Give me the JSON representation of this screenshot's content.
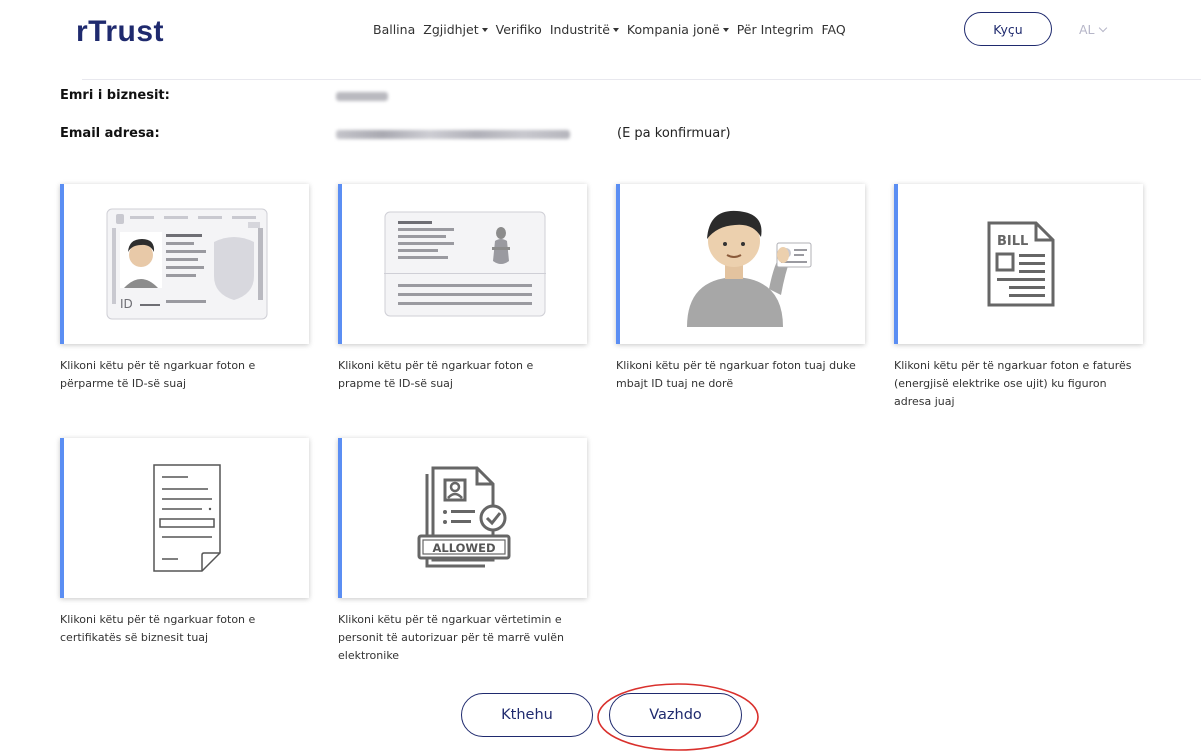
{
  "header": {
    "logo": "rTrust",
    "nav": [
      {
        "label": "Ballina",
        "dropdown": false
      },
      {
        "label": "Zgjidhjet",
        "dropdown": true
      },
      {
        "label": "Verifiko",
        "dropdown": false
      },
      {
        "label": "Industritë",
        "dropdown": true
      },
      {
        "label": "Kompania jonë",
        "dropdown": true
      },
      {
        "label": "Për Integrim",
        "dropdown": false
      },
      {
        "label": "FAQ",
        "dropdown": false
      }
    ],
    "login_label": "Kyçu",
    "language": "AL"
  },
  "info": {
    "business_name_label": "Emri i biznesit:",
    "email_label": "Email adresa:",
    "email_status": "(E pa konfirmuar)"
  },
  "cards": [
    {
      "caption": "Klikoni këtu për të ngarkuar foton e përparme të ID-së suaj",
      "icon": "id-card-front-icon"
    },
    {
      "caption": "Klikoni këtu për të ngarkuar foton e prapme të ID-së suaj",
      "icon": "id-card-back-icon"
    },
    {
      "caption": "Klikoni këtu për të ngarkuar foton tuaj duke mbajt ID tuaj ne dorë",
      "icon": "selfie-with-id-icon"
    },
    {
      "caption": "Klikoni këtu për të ngarkuar foton e faturës (energjisë elektrike ose ujit) ku figuron adresa juaj",
      "icon": "bill-document-icon",
      "icon_text": "BILL"
    },
    {
      "caption": "Klikoni këtu për të ngarkuar foton e certifikatës së biznesit tuaj",
      "icon": "certificate-document-icon"
    },
    {
      "caption": "Klikoni këtu për të ngarkuar vërtetimin e personit të autorizuar për të marrë vulën elektronike",
      "icon": "authorization-allowed-icon",
      "icon_text": "ALLOWED"
    }
  ],
  "buttons": {
    "back": "Kthehu",
    "continue": "Vazhdo"
  },
  "colors": {
    "brand": "#1f2a6e",
    "card_accent": "#5b8ef3",
    "annotation": "#d9302c"
  }
}
